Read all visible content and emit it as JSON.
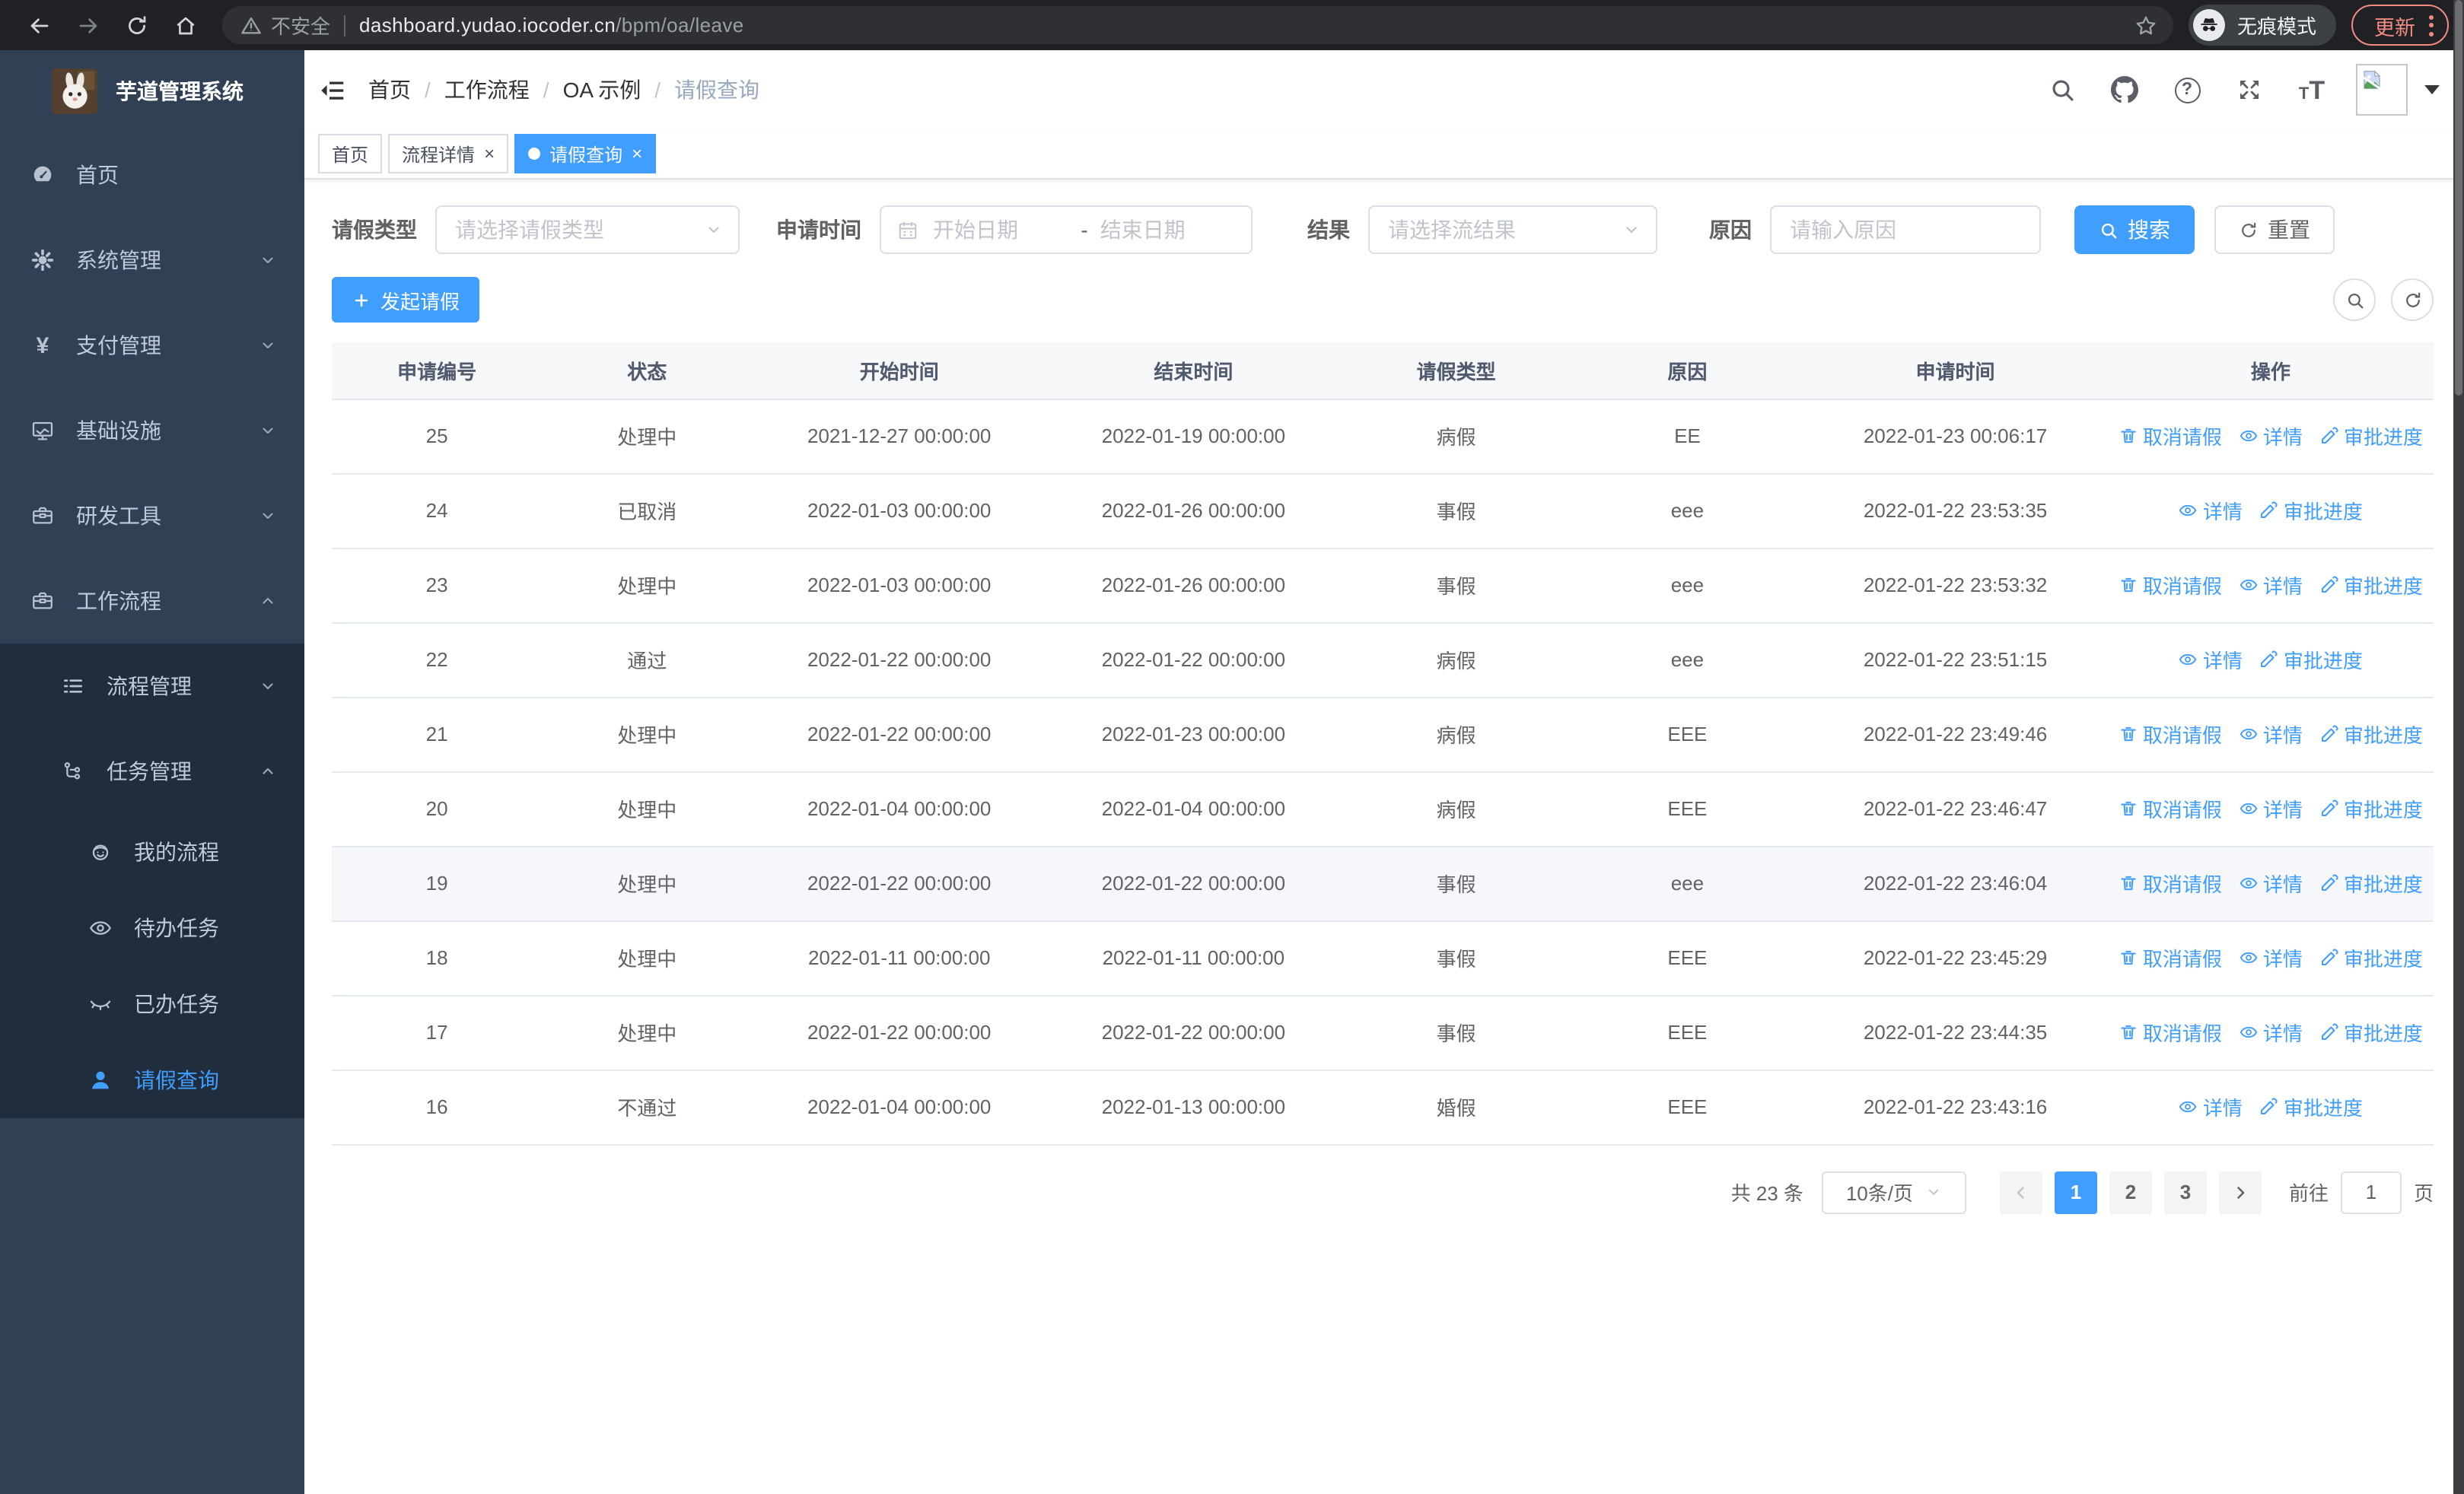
{
  "browser": {
    "security_label": "不安全",
    "url_host": "dashboard.yudao.iocoder.cn",
    "url_path": "/bpm/oa/leave",
    "incognito_label": "无痕模式",
    "update_label": "更新"
  },
  "sidebar": {
    "app_title": "芋道管理系统",
    "items": [
      {
        "key": "home",
        "label": "首页",
        "icon": "dashboard-icon",
        "level": 1
      },
      {
        "key": "system",
        "label": "系统管理",
        "icon": "gear-icon",
        "level": 1,
        "chevron": "down"
      },
      {
        "key": "payment",
        "label": "支付管理",
        "icon": "yen-icon",
        "level": 1,
        "chevron": "down"
      },
      {
        "key": "infrastructure",
        "label": "基础设施",
        "icon": "monitor-icon",
        "level": 1,
        "chevron": "down"
      },
      {
        "key": "dev-tools",
        "label": "研发工具",
        "icon": "toolbox-icon",
        "level": 1,
        "chevron": "down"
      },
      {
        "key": "workflow",
        "label": "工作流程",
        "icon": "briefcase-icon",
        "level": 1,
        "chevron": "up",
        "expanded": true
      },
      {
        "key": "process-mgmt",
        "label": "流程管理",
        "icon": "list-icon",
        "level": 2,
        "chevron": "down"
      },
      {
        "key": "task-mgmt",
        "label": "任务管理",
        "icon": "flow-icon",
        "level": 2,
        "chevron": "up"
      },
      {
        "key": "my-process",
        "label": "我的流程",
        "icon": "robot-icon",
        "level": 3
      },
      {
        "key": "todo-tasks",
        "label": "待办任务",
        "icon": "eye-icon",
        "level": 3
      },
      {
        "key": "done-tasks",
        "label": "已办任务",
        "icon": "eye-closed-icon",
        "level": 3
      },
      {
        "key": "leave-query",
        "label": "请假查询",
        "icon": "user-icon",
        "level": 3,
        "active": true
      }
    ]
  },
  "breadcrumb": [
    "首页",
    "工作流程",
    "OA 示例",
    "请假查询"
  ],
  "header_icons": [
    "search-icon",
    "github-icon",
    "help-icon",
    "fullscreen-icon",
    "font-size-icon"
  ],
  "tags": [
    {
      "key": "home",
      "label": "首页",
      "closable": false,
      "active": false
    },
    {
      "key": "process-detail",
      "label": "流程详情",
      "closable": true,
      "active": false
    },
    {
      "key": "leave-query",
      "label": "请假查询",
      "closable": true,
      "active": true
    }
  ],
  "filters": {
    "leave_type_label": "请假类型",
    "leave_type_placeholder": "请选择请假类型",
    "apply_time_label": "申请时间",
    "start_date_placeholder": "开始日期",
    "range_separator": "-",
    "end_date_placeholder": "结束日期",
    "result_label": "结果",
    "result_placeholder": "请选择流结果",
    "reason_label": "原因",
    "reason_placeholder": "请输入原因",
    "search_label": "搜索",
    "reset_label": "重置"
  },
  "toolbar": {
    "create_label": "发起请假"
  },
  "table": {
    "columns": [
      "申请编号",
      "状态",
      "开始时间",
      "结束时间",
      "请假类型",
      "原因",
      "申请时间",
      "操作"
    ],
    "action_labels": {
      "cancel": "取消请假",
      "detail": "详情",
      "progress": "审批进度"
    },
    "rows": [
      {
        "id": "25",
        "status": "处理中",
        "start": "2021-12-27 00:00:00",
        "end": "2022-01-19 00:00:00",
        "type": "病假",
        "reason": "EE",
        "apply_time": "2022-01-23 00:06:17",
        "actions": [
          "cancel",
          "detail",
          "progress"
        ]
      },
      {
        "id": "24",
        "status": "已取消",
        "start": "2022-01-03 00:00:00",
        "end": "2022-01-26 00:00:00",
        "type": "事假",
        "reason": "eee",
        "apply_time": "2022-01-22 23:53:35",
        "actions": [
          "detail",
          "progress"
        ]
      },
      {
        "id": "23",
        "status": "处理中",
        "start": "2022-01-03 00:00:00",
        "end": "2022-01-26 00:00:00",
        "type": "事假",
        "reason": "eee",
        "apply_time": "2022-01-22 23:53:32",
        "actions": [
          "cancel",
          "detail",
          "progress"
        ]
      },
      {
        "id": "22",
        "status": "通过",
        "start": "2022-01-22 00:00:00",
        "end": "2022-01-22 00:00:00",
        "type": "病假",
        "reason": "eee",
        "apply_time": "2022-01-22 23:51:15",
        "actions": [
          "detail",
          "progress"
        ]
      },
      {
        "id": "21",
        "status": "处理中",
        "start": "2022-01-22 00:00:00",
        "end": "2022-01-23 00:00:00",
        "type": "病假",
        "reason": "EEE",
        "apply_time": "2022-01-22 23:49:46",
        "actions": [
          "cancel",
          "detail",
          "progress"
        ]
      },
      {
        "id": "20",
        "status": "处理中",
        "start": "2022-01-04 00:00:00",
        "end": "2022-01-04 00:00:00",
        "type": "病假",
        "reason": "EEE",
        "apply_time": "2022-01-22 23:46:47",
        "actions": [
          "cancel",
          "detail",
          "progress"
        ]
      },
      {
        "id": "19",
        "status": "处理中",
        "start": "2022-01-22 00:00:00",
        "end": "2022-01-22 00:00:00",
        "type": "事假",
        "reason": "eee",
        "apply_time": "2022-01-22 23:46:04",
        "actions": [
          "cancel",
          "detail",
          "progress"
        ],
        "hover": true
      },
      {
        "id": "18",
        "status": "处理中",
        "start": "2022-01-11 00:00:00",
        "end": "2022-01-11 00:00:00",
        "type": "事假",
        "reason": "EEE",
        "apply_time": "2022-01-22 23:45:29",
        "actions": [
          "cancel",
          "detail",
          "progress"
        ]
      },
      {
        "id": "17",
        "status": "处理中",
        "start": "2022-01-22 00:00:00",
        "end": "2022-01-22 00:00:00",
        "type": "事假",
        "reason": "EEE",
        "apply_time": "2022-01-22 23:44:35",
        "actions": [
          "cancel",
          "detail",
          "progress"
        ]
      },
      {
        "id": "16",
        "status": "不通过",
        "start": "2022-01-04 00:00:00",
        "end": "2022-01-13 00:00:00",
        "type": "婚假",
        "reason": "EEE",
        "apply_time": "2022-01-22 23:43:16",
        "actions": [
          "detail",
          "progress"
        ]
      }
    ]
  },
  "pagination": {
    "total_label": "共 23 条",
    "page_size_label": "10条/页",
    "pages": [
      "1",
      "2",
      "3"
    ],
    "active_page": "1",
    "goto_label": "前往",
    "goto_value": "1",
    "page_suffix": "页"
  },
  "colors": {
    "accent": "#409eff",
    "sidebar_bg": "#304156",
    "submenu_bg": "#1f2d3d",
    "update_accent": "#f28b82"
  }
}
